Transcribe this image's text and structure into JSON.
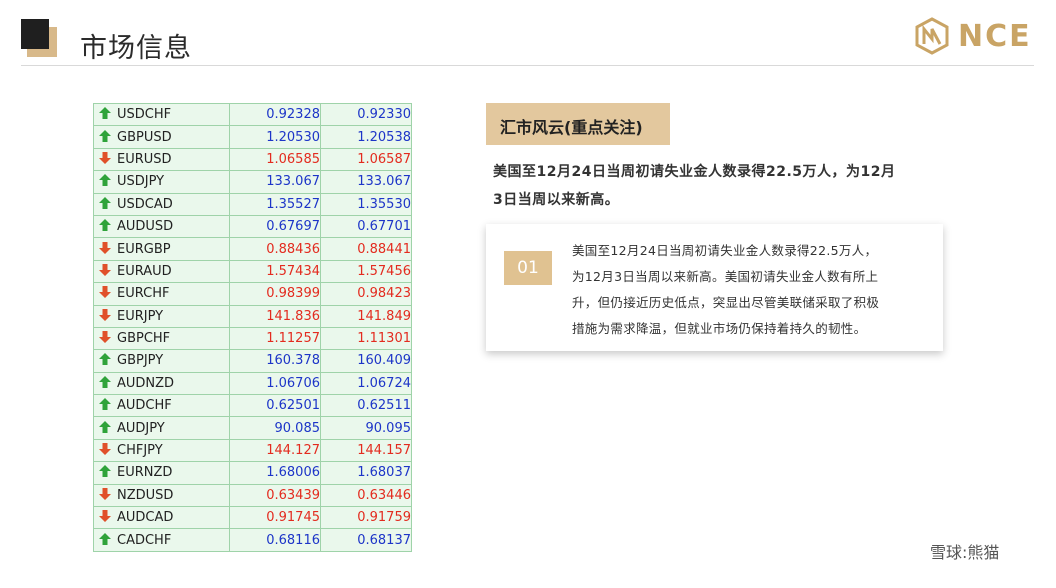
{
  "header": {
    "title": "市场信息"
  },
  "logo": {
    "text": "NCE"
  },
  "quotes": [
    {
      "symbol": "USDCHF",
      "dir": "up",
      "bid": "0.92328",
      "ask": "0.92330"
    },
    {
      "symbol": "GBPUSD",
      "dir": "up",
      "bid": "1.20530",
      "ask": "1.20538"
    },
    {
      "symbol": "EURUSD",
      "dir": "down",
      "bid": "1.06585",
      "ask": "1.06587"
    },
    {
      "symbol": "USDJPY",
      "dir": "up",
      "bid": "133.067",
      "ask": "133.067"
    },
    {
      "symbol": "USDCAD",
      "dir": "up",
      "bid": "1.35527",
      "ask": "1.35530"
    },
    {
      "symbol": "AUDUSD",
      "dir": "up",
      "bid": "0.67697",
      "ask": "0.67701"
    },
    {
      "symbol": "EURGBP",
      "dir": "down",
      "bid": "0.88436",
      "ask": "0.88441"
    },
    {
      "symbol": "EURAUD",
      "dir": "down",
      "bid": "1.57434",
      "ask": "1.57456"
    },
    {
      "symbol": "EURCHF",
      "dir": "down",
      "bid": "0.98399",
      "ask": "0.98423"
    },
    {
      "symbol": "EURJPY",
      "dir": "down",
      "bid": "141.836",
      "ask": "141.849"
    },
    {
      "symbol": "GBPCHF",
      "dir": "down",
      "bid": "1.11257",
      "ask": "1.11301"
    },
    {
      "symbol": "GBPJPY",
      "dir": "up",
      "bid": "160.378",
      "ask": "160.409"
    },
    {
      "symbol": "AUDNZD",
      "dir": "up",
      "bid": "1.06706",
      "ask": "1.06724"
    },
    {
      "symbol": "AUDCHF",
      "dir": "up",
      "bid": "0.62501",
      "ask": "0.62511"
    },
    {
      "symbol": "AUDJPY",
      "dir": "up",
      "bid": "90.085",
      "ask": "90.095"
    },
    {
      "symbol": "CHFJPY",
      "dir": "down",
      "bid": "144.127",
      "ask": "144.157"
    },
    {
      "symbol": "EURNZD",
      "dir": "up",
      "bid": "1.68006",
      "ask": "1.68037"
    },
    {
      "symbol": "NZDUSD",
      "dir": "down",
      "bid": "0.63439",
      "ask": "0.63446"
    },
    {
      "symbol": "AUDCAD",
      "dir": "down",
      "bid": "0.91745",
      "ask": "0.91759"
    },
    {
      "symbol": "CADCHF",
      "dir": "up",
      "bid": "0.68116",
      "ask": "0.68137"
    }
  ],
  "news": {
    "section_tag": "汇市风云(重点关注)",
    "headline_line1": "美国至12月24日当周初请失业金人数录得22.5万人，为12月",
    "headline_line2": "3日当周以来新高。",
    "card_number": "01",
    "card_lines": [
      "美国至12月24日当周初请失业金人数录得22.5万人，",
      "为12月3日当周以来新高。美国初请失业金人数有所上",
      "升，但仍接近历史低点，突显出尽管美联储采取了积极",
      "措施为需求降温，但就业市场仍保持着持久的韧性。"
    ]
  },
  "watermark": {
    "text": "雪球:熊猫"
  },
  "colors": {
    "up": "#1d35c8",
    "down": "#e32b1f",
    "gold": "#e0c291",
    "row_bg": "#eaf8ec",
    "grid": "#9fd3a9"
  },
  "icons": {
    "up": "green-up-arrow-icon",
    "down": "red-down-arrow-icon"
  }
}
